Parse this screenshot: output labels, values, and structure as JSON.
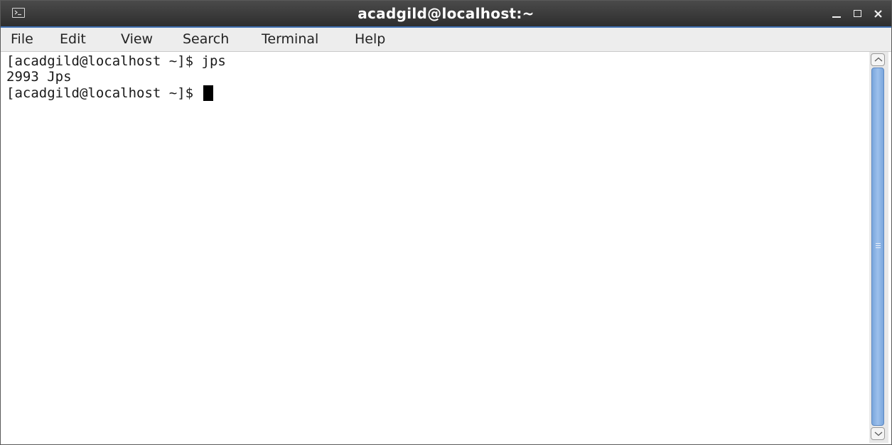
{
  "window": {
    "title": "acadgild@localhost:~",
    "icon": "terminal-icon",
    "controls": [
      "minimize-icon",
      "maximize-icon",
      "close-icon"
    ]
  },
  "menu": {
    "items": [
      "File",
      "Edit",
      "View",
      "Search",
      "Terminal",
      "Help"
    ]
  },
  "terminal": {
    "lines": [
      "[acadgild@localhost ~]$ jps",
      "2993 Jps",
      "[acadgild@localhost ~]$ "
    ]
  },
  "colors": {
    "titlebar": "#2e2e2e",
    "accent": "#3f6fb0",
    "scrollbar_thumb": "#8db3e2"
  }
}
